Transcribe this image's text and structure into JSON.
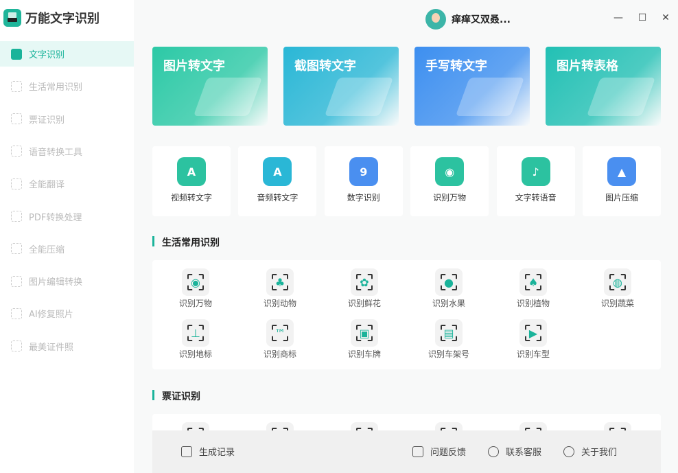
{
  "app": {
    "title": "万能文字识别"
  },
  "user": {
    "name": "痒痒又双叒..."
  },
  "window": {
    "minimize": "—",
    "maximize": "☐",
    "close": "✕"
  },
  "sidebar": {
    "items": [
      {
        "label": "文字识别",
        "active": true
      },
      {
        "label": "生活常用识别"
      },
      {
        "label": "票证识别"
      },
      {
        "label": "语音转换工具"
      },
      {
        "label": "全能翻译"
      },
      {
        "label": "PDF转换处理"
      },
      {
        "label": "全能压缩"
      },
      {
        "label": "图片编辑转换"
      },
      {
        "label": "AI修复照片"
      },
      {
        "label": "最美证件照"
      }
    ]
  },
  "banners": [
    {
      "label": "图片转文字",
      "color": "#2cc9a6"
    },
    {
      "label": "截图转文字",
      "color": "#2ab7d6"
    },
    {
      "label": "手写转文字",
      "color": "#3d8ff0"
    },
    {
      "label": "图片转表格",
      "color": "#22c0b4"
    }
  ],
  "tools": [
    {
      "label": "视频转文字",
      "glyph": "A"
    },
    {
      "label": "音频转文字",
      "glyph": "A"
    },
    {
      "label": "数字识别",
      "glyph": "9"
    },
    {
      "label": "识别万物",
      "glyph": "◉"
    },
    {
      "label": "文字转语音",
      "glyph": "♪"
    },
    {
      "label": "图片压缩",
      "glyph": "▲"
    }
  ],
  "sections": {
    "life": {
      "title": "生活常用识别",
      "items": [
        {
          "label": "识别万物",
          "glyph": "◉"
        },
        {
          "label": "识别动物",
          "glyph": "♣"
        },
        {
          "label": "识别鲜花",
          "glyph": "✿"
        },
        {
          "label": "识别水果",
          "glyph": "●"
        },
        {
          "label": "识别植物",
          "glyph": "♠"
        },
        {
          "label": "识别蔬菜",
          "glyph": "◍"
        },
        {
          "label": "识别地标",
          "glyph": "⊥"
        },
        {
          "label": "识别商标",
          "glyph": "™"
        },
        {
          "label": "识别车牌",
          "glyph": "▣"
        },
        {
          "label": "识别车架号",
          "glyph": "▤"
        },
        {
          "label": "识别车型",
          "glyph": "▶"
        }
      ]
    },
    "ticket": {
      "title": "票证识别"
    }
  },
  "footer": {
    "history": "生成记录",
    "feedback": "问题反馈",
    "service": "联系客服",
    "about": "关于我们"
  }
}
